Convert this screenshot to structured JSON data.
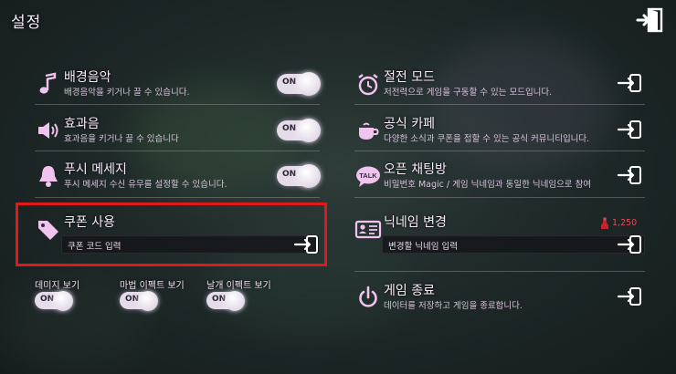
{
  "header": {
    "title": "설정",
    "exit_icon": "exit-door-icon"
  },
  "left": {
    "items": [
      {
        "label": "배경음악",
        "desc": "배경음악을 키거나 끌 수 있습니다.",
        "icon": "music-note-icon",
        "toggle": "ON"
      },
      {
        "label": "효과음",
        "desc": "효과음을 키거나 끌 수 있습니다",
        "icon": "speaker-icon",
        "toggle": "ON"
      },
      {
        "label": "푸시 메세지",
        "desc": "푸시 메세지 수신 유무를 설정할 수 있습니다.",
        "icon": "bell-icon",
        "toggle": "ON"
      }
    ],
    "coupon": {
      "label": "쿠폰 사용",
      "input_placeholder": "쿠폰 코드 입력",
      "icon": "tag-icon",
      "highlight_color": "#e01a1a"
    },
    "small_toggles": [
      {
        "label": "데미지 보기",
        "toggle": "ON"
      },
      {
        "label": "마법 이펙트 보기",
        "toggle": "ON"
      },
      {
        "label": "날개 이펙트 보기",
        "toggle": "ON"
      }
    ]
  },
  "right": {
    "items": [
      {
        "label": "절전 모드",
        "desc": "저전력으로 게임을 구동할 수 있는 모드입니다.",
        "icon": "alarm-clock-icon"
      },
      {
        "label": "공식 카페",
        "desc": "다양한 소식과 쿠폰을 접할 수 있는 공식 커뮤니티입니다.",
        "icon": "coffee-cup-icon"
      },
      {
        "label": "오픈 채팅방",
        "desc": "비밀번호 Magic / 게임 닉네임과 동일한 닉네임으로 참여",
        "icon": "talk-bubble-icon",
        "icon_text": "TALK"
      }
    ],
    "nickname": {
      "label": "닉네임 변경",
      "input_placeholder": "변경할 닉네임 입력",
      "price": "1,250",
      "icon": "id-card-icon",
      "price_icon": "potion-icon"
    },
    "quit": {
      "label": "게임 종료",
      "desc": "데이터를 저장하고 게임을 종료합니다.",
      "icon": "power-icon"
    }
  },
  "colors": {
    "accent": "#e5dcea",
    "text": "#f4e6f6",
    "price": "#e34b57"
  }
}
